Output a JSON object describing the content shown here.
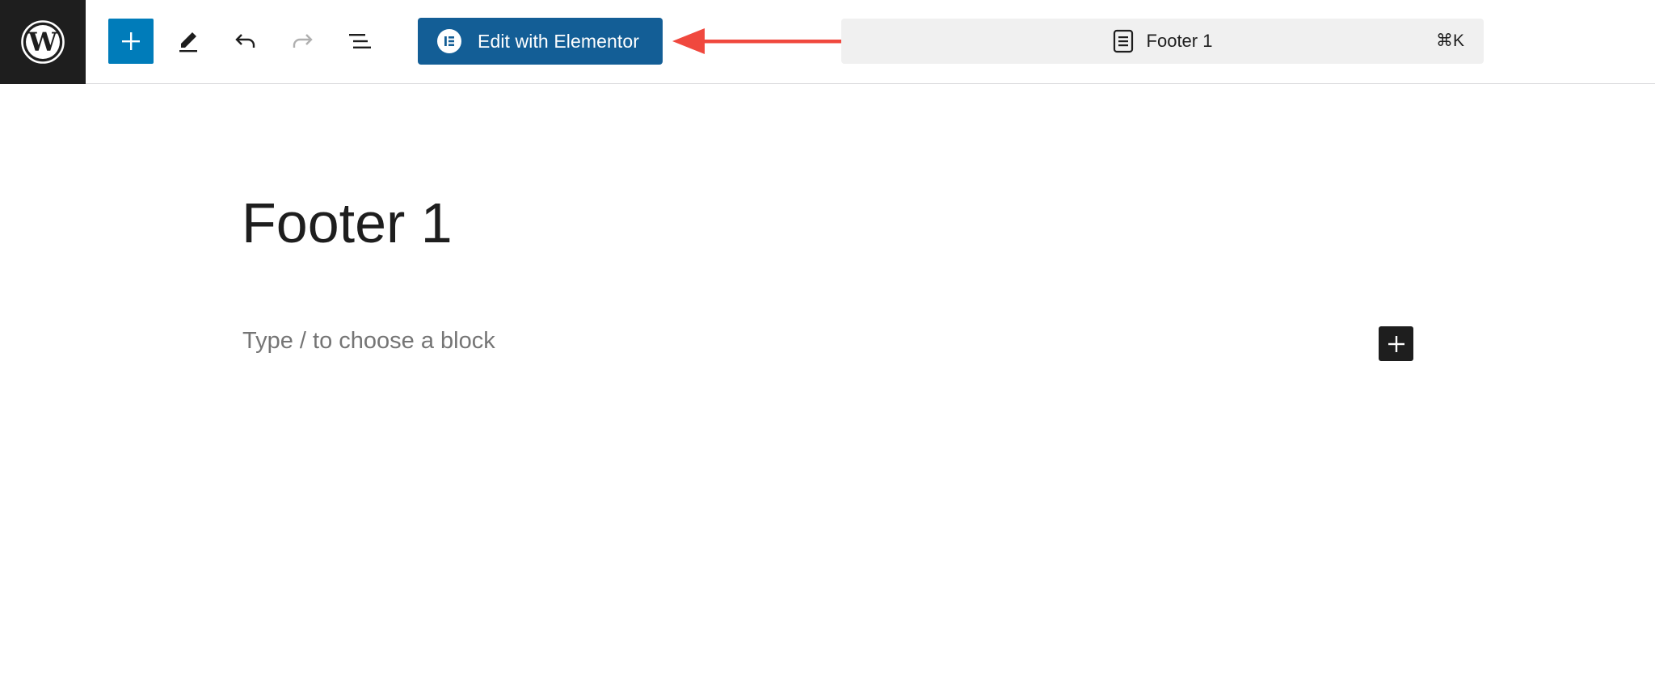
{
  "toolbar": {
    "wordpress_logo": "wordpress-logo",
    "inserter_icon": "plus-icon",
    "tools_icon": "pencil-icon",
    "undo_icon": "undo-icon",
    "redo_icon": "redo-icon",
    "outline_icon": "list-view-icon",
    "elementor_button_label": "Edit with Elementor",
    "accent_color": "#007cba",
    "elementor_color": "#135e96"
  },
  "annotation": {
    "arrow_color": "#f0483e",
    "arrow_direction": "left"
  },
  "command_bar": {
    "title": "Footer 1",
    "shortcut": "⌘K"
  },
  "editor": {
    "post_title": "Footer 1",
    "block_placeholder": "Type / to choose a block"
  }
}
